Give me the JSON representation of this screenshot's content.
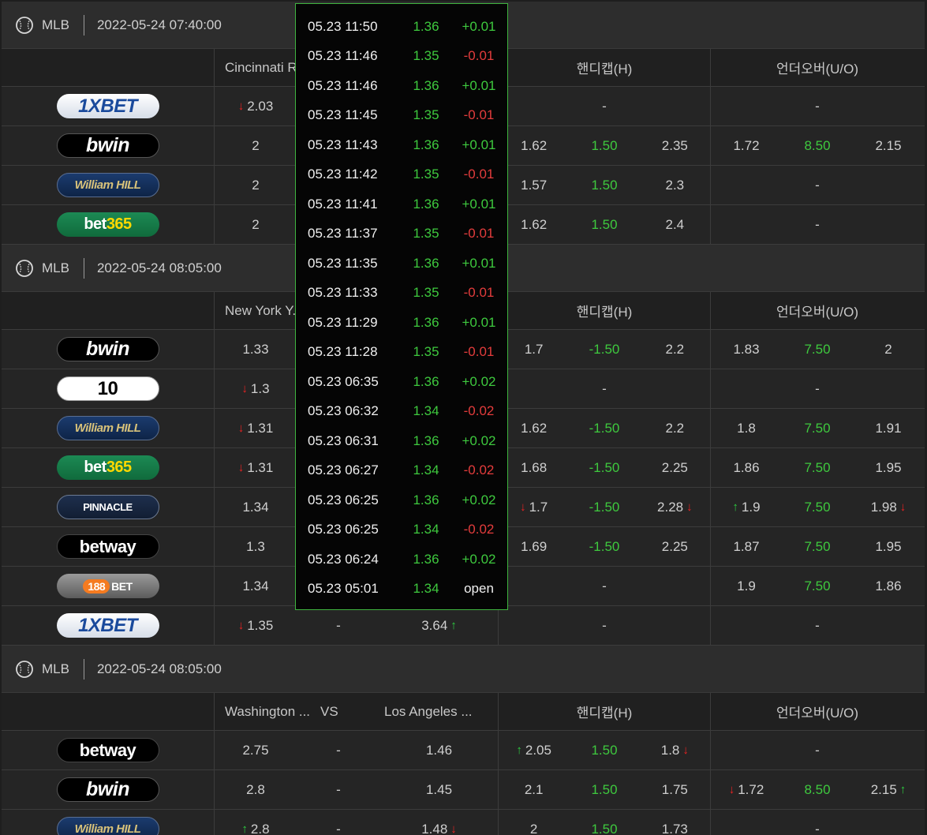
{
  "colors": {
    "accent_green": "#3ec93e",
    "up_arrow": "#2ecc40",
    "down_arrow": "#ee2222",
    "popup_border": "#3fb43f"
  },
  "icons": {
    "sport": "baseball-icon",
    "up": "up-arrow-icon",
    "down": "down-arrow-icon"
  },
  "labels": {
    "handicap": "핸디캡(H)",
    "over_under": "언더오버(U/O)",
    "vs": "VS",
    "dash": "-"
  },
  "sections": [
    {
      "league": "MLB",
      "datetime": "2022-05-24 07:40:00",
      "home": "Cincinnati R...",
      "away": "",
      "show_vs": false,
      "rows": [
        {
          "book": "1xbet",
          "h": {
            "v": "2.03",
            "arrow": "down"
          },
          "d": {
            "v": ""
          },
          "a": {
            "v": ""
          },
          "hcp": {
            "full": "-"
          },
          "ou": {
            "full": "-"
          }
        },
        {
          "book": "bwin",
          "h": {
            "v": "2"
          },
          "d": {
            "v": ""
          },
          "a": {
            "v": ""
          },
          "hcp": {
            "h": {
              "v": "1.62"
            },
            "line": "1.50",
            "a": {
              "v": "2.35"
            }
          },
          "ou": {
            "o": {
              "v": "1.72"
            },
            "line": "8.50",
            "u": {
              "v": "2.15"
            }
          }
        },
        {
          "book": "williamhill",
          "h": {
            "v": "2"
          },
          "d": {
            "v": ""
          },
          "a": {
            "v": ""
          },
          "hcp": {
            "h": {
              "v": "1.57"
            },
            "line": "1.50",
            "a": {
              "v": "2.3"
            }
          },
          "ou": {
            "full": "-"
          }
        },
        {
          "book": "bet365",
          "h": {
            "v": "2"
          },
          "d": {
            "v": ""
          },
          "a": {
            "v": ""
          },
          "hcp": {
            "h": {
              "v": "1.62"
            },
            "line": "1.50",
            "a": {
              "v": "2.4"
            }
          },
          "ou": {
            "full": "-"
          }
        }
      ]
    },
    {
      "league": "MLB",
      "datetime": "2022-05-24 08:05:00",
      "home": "New York Y...",
      "away": "",
      "show_vs": false,
      "rows": [
        {
          "book": "bwin",
          "h": {
            "v": "1.33"
          },
          "d": {
            "v": ""
          },
          "a": {
            "v": ""
          },
          "hcp": {
            "h": {
              "v": "1.7"
            },
            "line": "-1.50",
            "a": {
              "v": "2.2"
            }
          },
          "ou": {
            "o": {
              "v": "1.83"
            },
            "line": "7.50",
            "u": {
              "v": "2"
            }
          }
        },
        {
          "book": "10bet",
          "h": {
            "v": "1.3",
            "arrow": "down"
          },
          "d": {
            "v": ""
          },
          "a": {
            "v": ""
          },
          "hcp": {
            "full": "-"
          },
          "ou": {
            "full": "-"
          }
        },
        {
          "book": "williamhill",
          "h": {
            "v": "1.31",
            "arrow": "down"
          },
          "d": {
            "v": ""
          },
          "a": {
            "v": ""
          },
          "hcp": {
            "h": {
              "v": "1.62"
            },
            "line": "-1.50",
            "a": {
              "v": "2.2"
            }
          },
          "ou": {
            "o": {
              "v": "1.8"
            },
            "line": "7.50",
            "u": {
              "v": "1.91"
            }
          }
        },
        {
          "book": "bet365",
          "h": {
            "v": "1.31",
            "arrow": "down"
          },
          "d": {
            "v": ""
          },
          "a": {
            "v": ""
          },
          "hcp": {
            "h": {
              "v": "1.68"
            },
            "line": "-1.50",
            "a": {
              "v": "2.25"
            }
          },
          "ou": {
            "o": {
              "v": "1.86"
            },
            "line": "7.50",
            "u": {
              "v": "1.95"
            }
          }
        },
        {
          "book": "pinnacle",
          "h": {
            "v": "1.34"
          },
          "d": {
            "v": ""
          },
          "a": {
            "v": ""
          },
          "hcp": {
            "h": {
              "v": "1.7",
              "arrow": "down"
            },
            "line": "-1.50",
            "a": {
              "v": "2.28",
              "arrow": "down"
            }
          },
          "ou": {
            "o": {
              "v": "1.9",
              "arrow": "up"
            },
            "line": "7.50",
            "u": {
              "v": "1.98",
              "arrow": "down"
            }
          }
        },
        {
          "book": "betway",
          "h": {
            "v": "1.3"
          },
          "d": {
            "v": ""
          },
          "a": {
            "v": ""
          },
          "hcp": {
            "h": {
              "v": "1.69"
            },
            "line": "-1.50",
            "a": {
              "v": "2.25"
            }
          },
          "ou": {
            "o": {
              "v": "1.87"
            },
            "line": "7.50",
            "u": {
              "v": "1.95"
            }
          }
        },
        {
          "book": "188bet",
          "h": {
            "v": "1.34"
          },
          "d": {
            "v": ""
          },
          "a": {
            "v": ""
          },
          "hcp": {
            "full": "-"
          },
          "ou": {
            "o": {
              "v": "1.9"
            },
            "line": "7.50",
            "u": {
              "v": "1.86"
            }
          }
        },
        {
          "book": "1xbet",
          "h": {
            "v": "1.35",
            "arrow": "down"
          },
          "d": {
            "v": "-"
          },
          "a": {
            "v": "3.64",
            "arrow": "up"
          },
          "hcp": {
            "full": "-"
          },
          "ou": {
            "full": "-"
          }
        }
      ]
    },
    {
      "league": "MLB",
      "datetime": "2022-05-24 08:05:00",
      "home": "Washington ...",
      "away": "Los Angeles ...",
      "show_vs": true,
      "rows": [
        {
          "book": "betway",
          "h": {
            "v": "2.75"
          },
          "d": {
            "v": "-"
          },
          "a": {
            "v": "1.46"
          },
          "hcp": {
            "h": {
              "v": "2.05",
              "arrow": "up"
            },
            "line": "1.50",
            "a": {
              "v": "1.8",
              "arrow": "down"
            }
          },
          "ou": {
            "full": "-"
          }
        },
        {
          "book": "bwin",
          "h": {
            "v": "2.8"
          },
          "d": {
            "v": "-"
          },
          "a": {
            "v": "1.45"
          },
          "hcp": {
            "h": {
              "v": "2.1"
            },
            "line": "1.50",
            "a": {
              "v": "1.75"
            }
          },
          "ou": {
            "o": {
              "v": "1.72",
              "arrow": "down"
            },
            "line": "8.50",
            "u": {
              "v": "2.15",
              "arrow": "up"
            }
          }
        },
        {
          "book": "williamhill",
          "h": {
            "v": "2.8",
            "arrow": "up"
          },
          "d": {
            "v": "-"
          },
          "a": {
            "v": "1.48",
            "arrow": "down"
          },
          "hcp": {
            "h": {
              "v": "2"
            },
            "line": "1.50",
            "a": {
              "v": "1.73"
            }
          },
          "ou": {
            "full": "-"
          }
        }
      ]
    }
  ],
  "bookmakers": {
    "1xbet": "1XBET",
    "bwin": "bwin",
    "williamhill": "William HILL",
    "bet365": "bet365",
    "10bet": "10",
    "pinnacle": "PINNACLE",
    "betway": "betway",
    "188bet": "188BET"
  },
  "odds_history": [
    {
      "time": "05.23 11:50",
      "value": "1.36",
      "change": "+0.01"
    },
    {
      "time": "05.23 11:46",
      "value": "1.35",
      "change": "-0.01"
    },
    {
      "time": "05.23 11:46",
      "value": "1.36",
      "change": "+0.01"
    },
    {
      "time": "05.23 11:45",
      "value": "1.35",
      "change": "-0.01"
    },
    {
      "time": "05.23 11:43",
      "value": "1.36",
      "change": "+0.01"
    },
    {
      "time": "05.23 11:42",
      "value": "1.35",
      "change": "-0.01"
    },
    {
      "time": "05.23 11:41",
      "value": "1.36",
      "change": "+0.01"
    },
    {
      "time": "05.23 11:37",
      "value": "1.35",
      "change": "-0.01"
    },
    {
      "time": "05.23 11:35",
      "value": "1.36",
      "change": "+0.01"
    },
    {
      "time": "05.23 11:33",
      "value": "1.35",
      "change": "-0.01"
    },
    {
      "time": "05.23 11:29",
      "value": "1.36",
      "change": "+0.01"
    },
    {
      "time": "05.23 11:28",
      "value": "1.35",
      "change": "-0.01"
    },
    {
      "time": "05.23 06:35",
      "value": "1.36",
      "change": "+0.02"
    },
    {
      "time": "05.23 06:32",
      "value": "1.34",
      "change": "-0.02"
    },
    {
      "time": "05.23 06:31",
      "value": "1.36",
      "change": "+0.02"
    },
    {
      "time": "05.23 06:27",
      "value": "1.34",
      "change": "-0.02"
    },
    {
      "time": "05.23 06:25",
      "value": "1.36",
      "change": "+0.02"
    },
    {
      "time": "05.23 06:25",
      "value": "1.34",
      "change": "-0.02"
    },
    {
      "time": "05.23 06:24",
      "value": "1.36",
      "change": "+0.02"
    },
    {
      "time": "05.23 05:01",
      "value": "1.34",
      "change": "open"
    }
  ]
}
